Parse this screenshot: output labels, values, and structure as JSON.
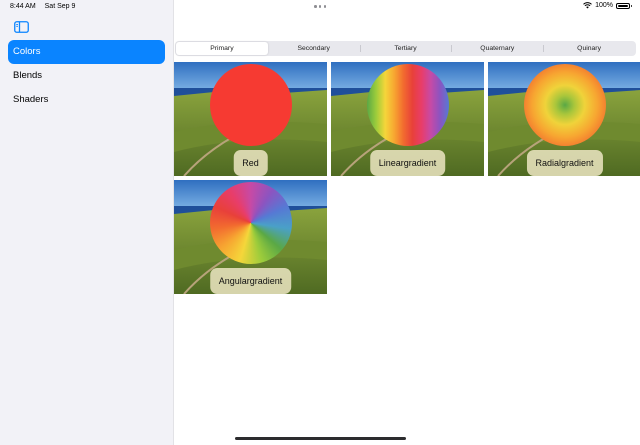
{
  "status": {
    "time": "8:44 AM",
    "date": "Sat Sep 9",
    "battery": "100%"
  },
  "sidebar": {
    "toggle_icon": "sidebar-icon",
    "items": [
      {
        "label": "Colors",
        "selected": true
      },
      {
        "label": "Blends",
        "selected": false
      },
      {
        "label": "Shaders",
        "selected": false
      }
    ]
  },
  "segments": [
    "Primary",
    "Secondary",
    "Tertiary",
    "Quaternary",
    "Quinary"
  ],
  "active_segment": "Primary",
  "tiles": [
    {
      "label": "Red"
    },
    {
      "label": "Lineargradient"
    },
    {
      "label": "Radialgradient"
    },
    {
      "label": "Angulargradient"
    }
  ],
  "colors": {
    "accent": "#0a84ff",
    "red": "#ff3b30"
  }
}
